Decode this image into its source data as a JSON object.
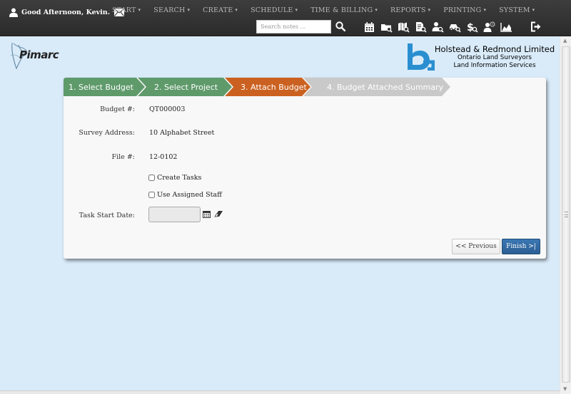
{
  "header": {
    "greeting": "Good Afternoon, Kevin.",
    "user_icon": "user-icon",
    "mail_icon": "envelope-icon",
    "menu": [
      {
        "label": "START",
        "caret": "▾"
      },
      {
        "label": "SEARCH",
        "caret": "▾"
      },
      {
        "label": "CREATE",
        "caret": "▾"
      },
      {
        "label": "SCHEDULE",
        "caret": "▾"
      },
      {
        "label": "TIME & BILLING",
        "caret": "▾"
      },
      {
        "label": "REPORTS",
        "caret": "▾"
      },
      {
        "label": "PRINTING",
        "caret": "▾"
      },
      {
        "label": "SYSTEM",
        "caret": "▾"
      }
    ],
    "search_placeholder": "Search notes ...",
    "search_icon": "magnifier-icon",
    "toolbar_icons": [
      "calendar-icon",
      "folder-search-icon",
      "map-search-icon",
      "document-search-icon",
      "person-search-icon",
      "car-search-icon",
      "dollar-search-icon",
      "user-clock-icon",
      "area-chart-icon"
    ],
    "logout_icon": "sign-out-icon"
  },
  "branding": {
    "app_logo_text": "Pimarc",
    "company_name": "Holstead & Redmond Limited",
    "company_line2": "Ontario Land Surveyors",
    "company_line3": "Land Information Services"
  },
  "wizard": {
    "steps": [
      {
        "label": "1. Select Budget",
        "state": "complete"
      },
      {
        "label": "2. Select Project",
        "state": "complete"
      },
      {
        "label": "3. Attach Budget",
        "state": "active"
      },
      {
        "label": "4. Budget Attached Summary",
        "state": "pending"
      }
    ],
    "fields": {
      "budget_label": "Budget #:",
      "budget_value": "QT000003",
      "address_label": "Survey Address:",
      "address_value": "10 Alphabet Street",
      "file_label": "File #:",
      "file_value": "12-0102",
      "create_tasks_label": "Create Tasks",
      "create_tasks_checked": false,
      "use_staff_label": "Use Assigned Staff",
      "use_staff_checked": false,
      "start_date_label": "Task Start Date:",
      "start_date_value": ""
    },
    "buttons": {
      "previous": "<< Previous",
      "finish": "Finish >|"
    }
  },
  "colors": {
    "navbar": "#333333",
    "background": "#d9ebf9",
    "step_complete": "#5f9a6b",
    "step_active": "#cb6120",
    "step_pending": "#c9c9c9",
    "primary_button": "#2f679e",
    "logo_blue": "#2a8fd0"
  }
}
